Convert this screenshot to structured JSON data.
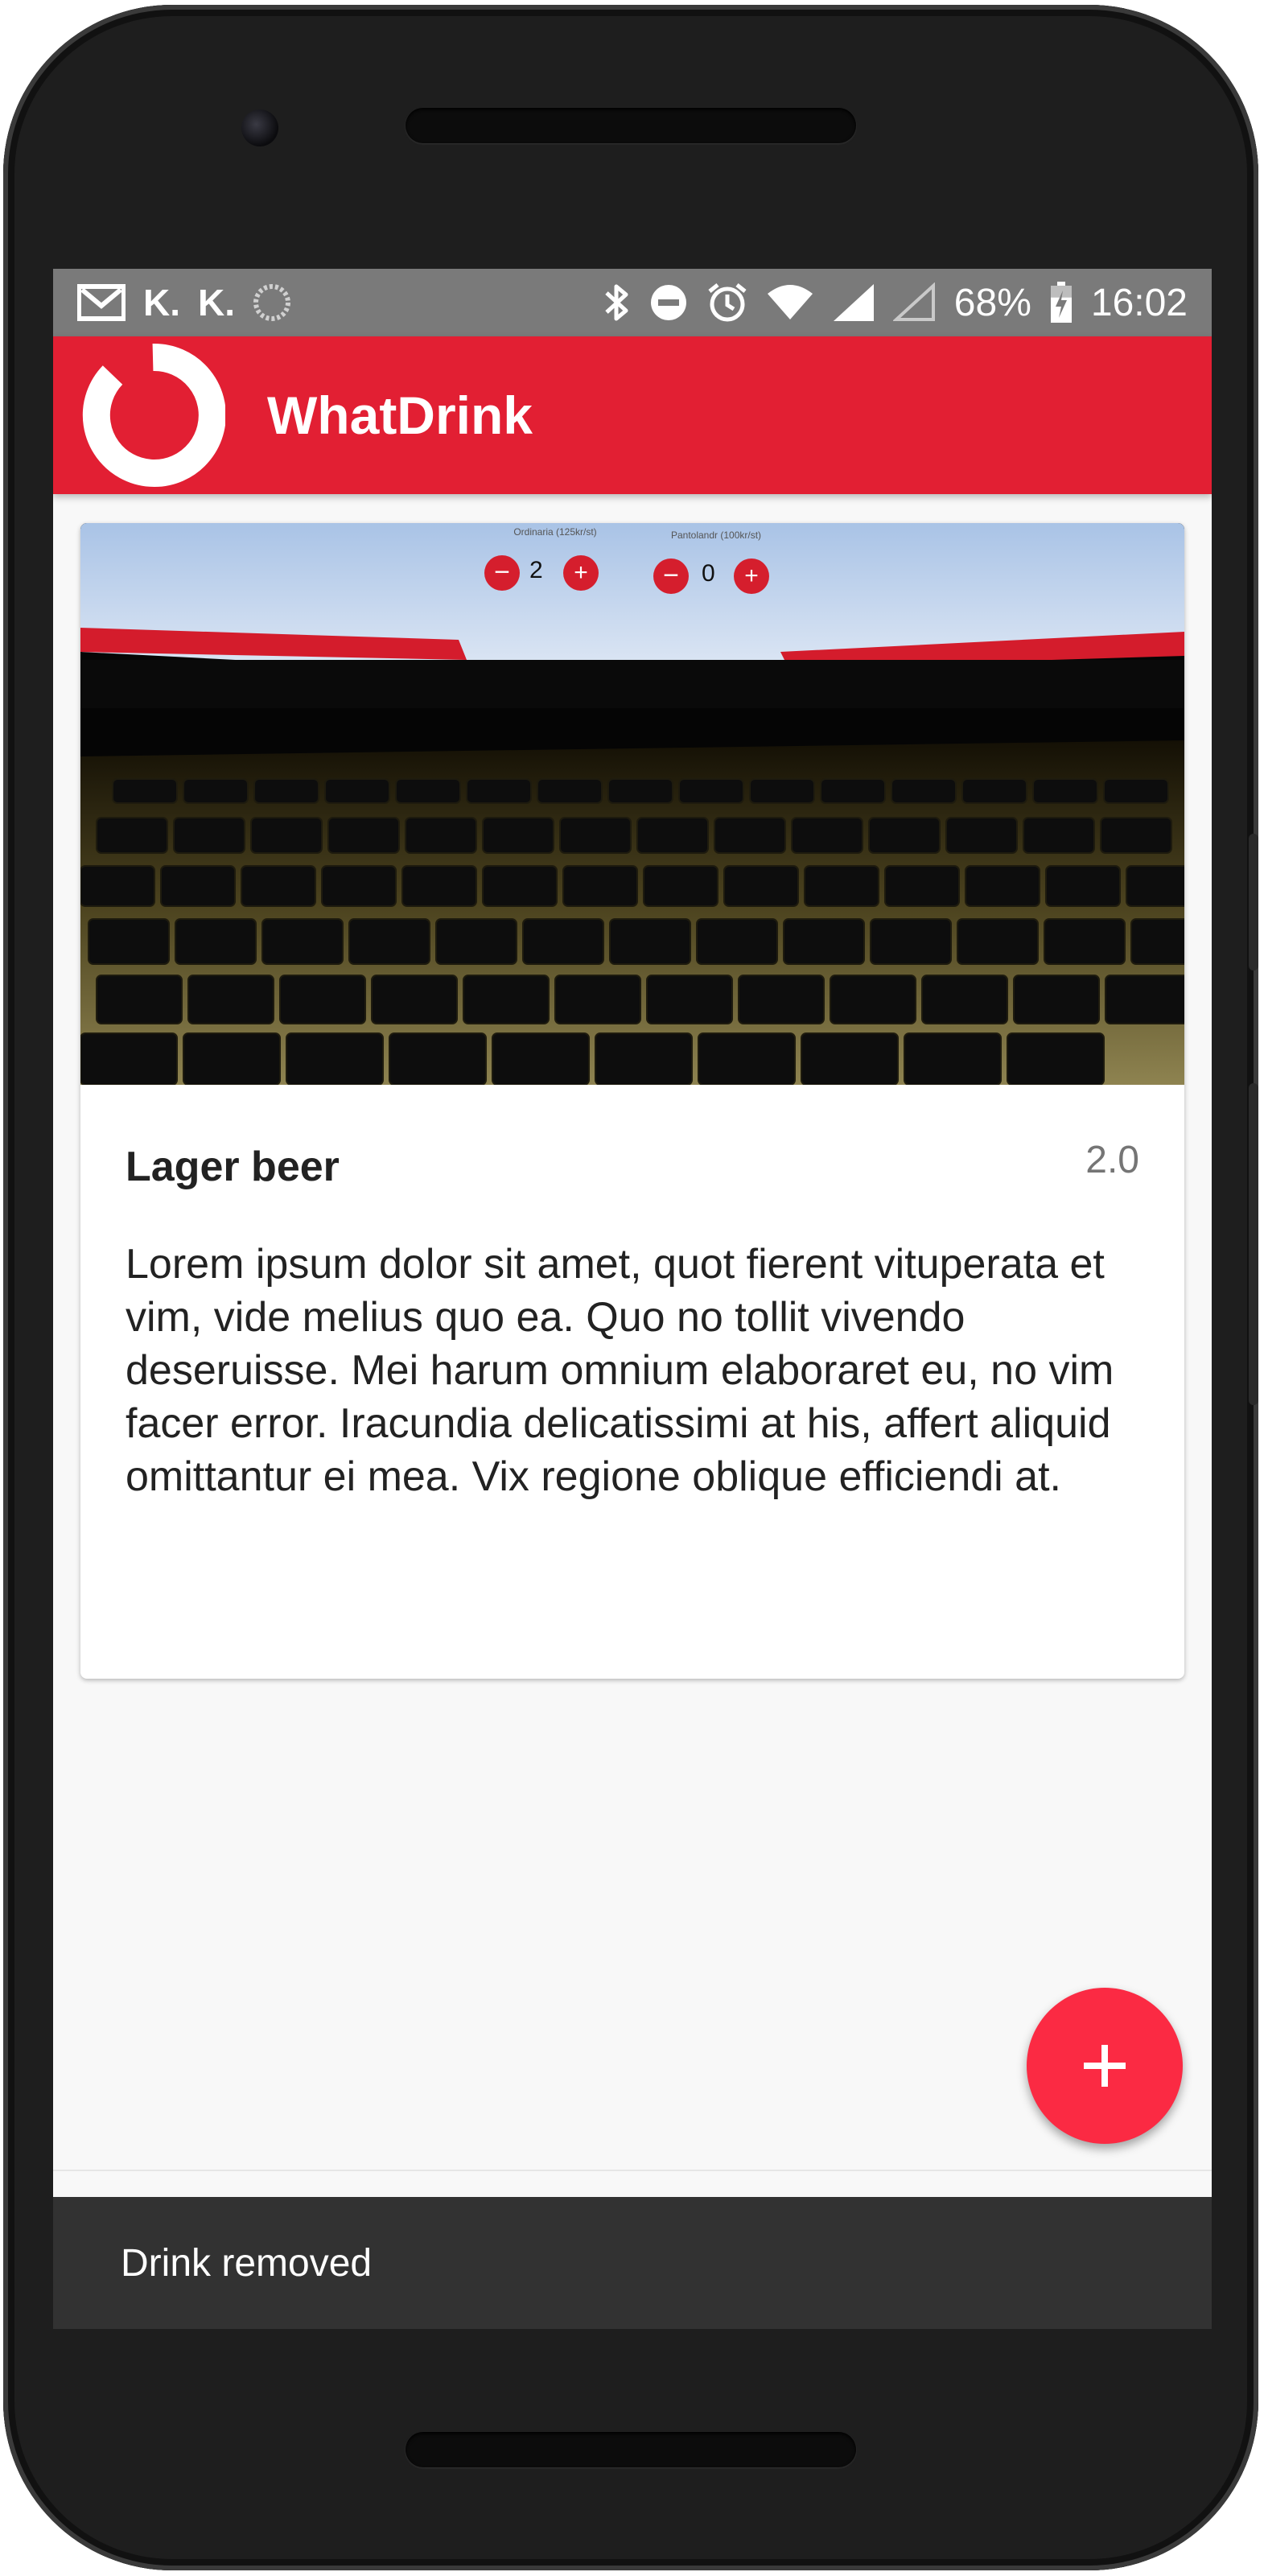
{
  "status_bar": {
    "left_icons": [
      "gmail-icon",
      "k-app-icon",
      "k-app-icon",
      "sync-icon"
    ],
    "k_label": "K.",
    "right_icons": [
      "bluetooth-icon",
      "do-not-disturb-icon",
      "alarm-icon",
      "wifi-icon",
      "signal-icon",
      "signal-empty-icon"
    ],
    "battery_percent": "68%",
    "battery_level": 0.68,
    "time": "16:02"
  },
  "app_bar": {
    "title": "WhatDrink",
    "logo_icon": "ring-logo-icon",
    "color": "#e21f33"
  },
  "card": {
    "image_icon": "laptop-keyboard-photo",
    "photo_ui": {
      "left_label": "Ordinaria (125kr/st)",
      "left_count": "2",
      "right_label": "Pantolandr (100kr/st)",
      "right_count": "0",
      "minus": "−",
      "plus": "+"
    },
    "title": "Lager beer",
    "rating": "2.0",
    "description": "Lorem ipsum dolor sit amet, quot fierent vituperata et vim, vide melius quo ea. Quo no tollit vivendo deseruisse. Mei harum omnium elaboraret eu, no vim facer error. Iracundia delicatissimi at his, affert aliquid omittantur ei mea. Vix regione oblique efficiendi at."
  },
  "fab": {
    "icon": "plus-icon",
    "color": "#fb2a43"
  },
  "snackbar": {
    "message": "Drink removed"
  }
}
